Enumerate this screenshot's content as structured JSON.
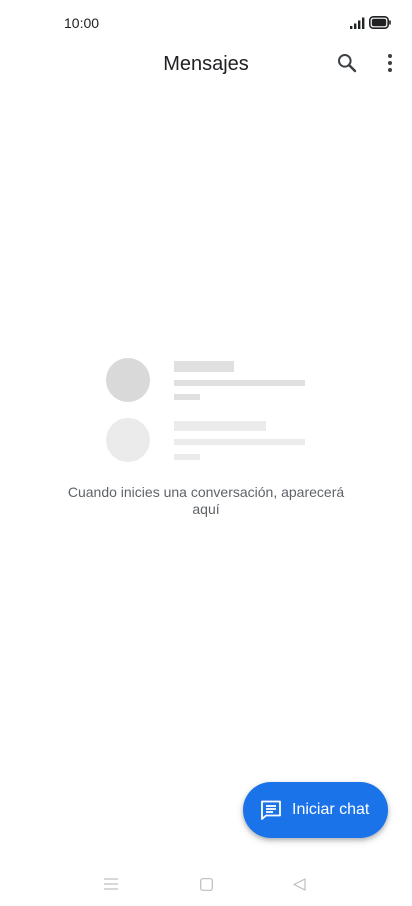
{
  "status_bar": {
    "time": "10:00",
    "icons": [
      "signal-icon",
      "battery-icon"
    ]
  },
  "app_bar": {
    "title": "Mensajes",
    "actions": [
      "search-icon",
      "more-vert-icon"
    ]
  },
  "empty_state": {
    "message": "Cuando inicies una conversación, aparecerá aquí"
  },
  "fab": {
    "label": "Iniciar chat",
    "icon": "chat-message-icon"
  },
  "navigation_bar": {
    "icons": [
      "menu-icon",
      "home-square-icon",
      "back-triangle-icon"
    ]
  },
  "colors": {
    "accent": "#1a73e8",
    "text_primary": "#202124",
    "text_secondary": "#5f6368",
    "placeholder_dark": "#d9d9d9",
    "placeholder_light": "#ebebeb"
  }
}
